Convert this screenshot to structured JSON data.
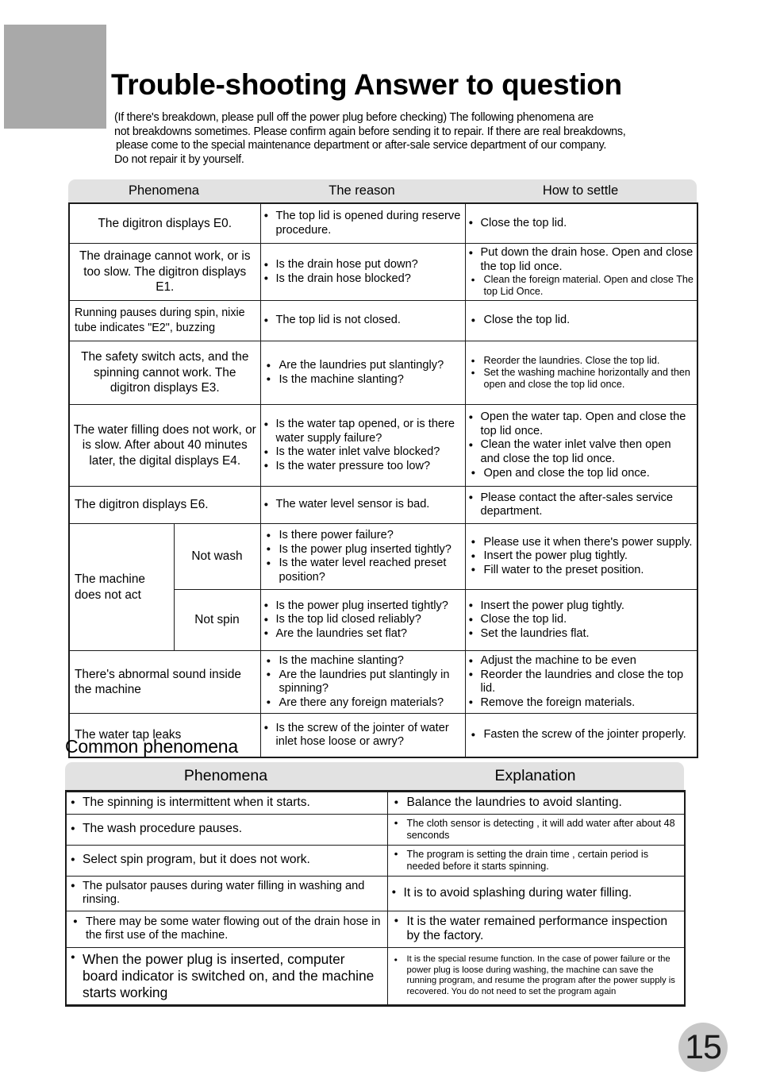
{
  "page": {
    "title": "Trouble-shooting  Answer to question",
    "page_number": "15",
    "intro": [
      "(If  there's  breakdown,  please pull off the power plug before checking)  The following phenomena are",
      "not breakdowns sometimes.  Please confirm again before sending it to repair. If there are real breakdowns,",
      " please come to the special maintenance department or after-sale service department of our company.",
      "Do not repair it by yourself."
    ],
    "accent_gray": "#a9a9a9",
    "header_gray": "#e2e2e2"
  },
  "main_table": {
    "headers": [
      "Phenomena",
      "The reason",
      "How to settle"
    ],
    "rows": [
      {
        "phenomena": "The digitron displays E0.",
        "reasons": [
          "The top lid is opened during reserve procedure."
        ],
        "settle": [
          "Close the top lid."
        ]
      },
      {
        "phenomena": "The drainage cannot work, or is too slow. The digitron displays E1.",
        "reasons": [
          "Is the drain hose put down?",
          "Is the drain hose blocked?"
        ],
        "settle": [
          "Put down the drain hose. Open and close the  top lid once.",
          "Clean the foreign material. Open and close The top Lid Once."
        ]
      },
      {
        "phenomena": "Running pauses during spin, nixie tube indicates \"E2\", buzzing",
        "reasons": [
          "The top lid is not closed."
        ],
        "settle": [
          "Close the top lid."
        ]
      },
      {
        "phenomena": "The safety switch acts, and the spinning cannot work. The digitron displays E3.",
        "reasons": [
          "Are the laundries put slantingly?",
          "Is the machine slanting?"
        ],
        "settle": [
          "Reorder the laundries. Close the top lid.",
          "Set the washing machine horizontally and then open and close the top lid once."
        ]
      },
      {
        "phenomena": "The water filling does not work, or is slow. After about 40 minutes later, the digital displays E4.",
        "reasons": [
          "Is the water tap opened, or is there water supply failure?",
          "Is the water inlet valve blocked?",
          "Is the water pressure too low?"
        ],
        "settle": [
          "Open the water tap. Open and close the top lid once.",
          "Clean the water inlet valve then open and close the top lid once.",
          "Open and close the top lid  once."
        ]
      },
      {
        "phenomena": "The digitron displays E6.",
        "reasons": [
          "The water level sensor is bad."
        ],
        "settle": [
          "Please contact the after-sales service department."
        ]
      },
      {
        "phenomena": "The machine does not act",
        "sub_label": "Not wash",
        "reasons": [
          "Is there power failure?",
          "Is the power plug inserted tightly?",
          "Is the water level reached preset position?"
        ],
        "settle": [
          "Please use it when there's power supply.",
          "Insert the power plug tightly.",
          "Fill water to the preset position."
        ]
      },
      {
        "sub_label": "Not spin",
        "reasons": [
          "Is the power plug inserted tightly?",
          "Is the top lid closed reliably?",
          "Are the laundries set flat?"
        ],
        "settle": [
          "Insert the power plug tightly.",
          "Close the top lid.",
          "Set the laundries flat."
        ]
      },
      {
        "phenomena": "There's abnormal sound inside the machine",
        "reasons": [
          "Is the machine slanting?",
          "Are the laundries put slantingly in spinning?",
          "Are there any foreign materials?"
        ],
        "settle": [
          "Adjust the machine to be even",
          "Reorder the laundries and close the top lid.",
          "Remove the foreign materials."
        ]
      },
      {
        "phenomena": "The water tap leaks",
        "reasons": [
          "Is the screw of the jointer of water inlet hose loose or awry?"
        ],
        "settle": [
          "Fasten the screw of the jointer properly."
        ]
      }
    ]
  },
  "common_section": {
    "heading": "Common phenomena",
    "headers": [
      "Phenomena",
      "Explanation"
    ],
    "rows": [
      {
        "phenomena": "The spinning is intermittent when it starts.",
        "explanation": "Balance the laundries to avoid slanting."
      },
      {
        "phenomena": "The wash procedure pauses.",
        "explanation": "The cloth sensor is detecting , it will add water after about 48 senconds"
      },
      {
        "phenomena": "Select spin program, but it does not work.",
        "explanation": "The program is setting the drain time , certain period is needed before it starts spinning."
      },
      {
        "phenomena": "The pulsator pauses during water filling in washing and rinsing.",
        "explanation": "It is to avoid splashing during water filling."
      },
      {
        "phenomena": "There may be some water flowing out of the drain hose in the first use of the machine.",
        "explanation": "It is the water remained performance inspection by the factory."
      },
      {
        "phenomena": "When the power plug is inserted, computer board indicator is switched on, and the machine starts working",
        "explanation": "It is the special resume function. In the case of power failure or the power plug is loose during washing, the machine can save the running program, and resume the program after the power supply is recovered. You do not need to set the program again"
      }
    ]
  }
}
